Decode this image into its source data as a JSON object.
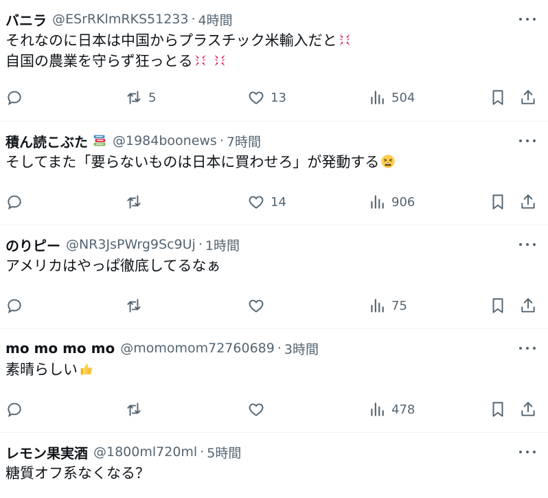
{
  "replies": [
    {
      "display_name": "バニラ",
      "handle": "@ESrRKlmRKS51233",
      "time": "4時間",
      "lines": [
        "それなのに日本は中国からプラスチック米輸入だと",
        "自国の農業を守らず狂っとる"
      ],
      "line_emojis": [
        [
          "anger-emoji"
        ],
        [
          "anger-emoji",
          "anger-emoji"
        ]
      ],
      "reposts": "5",
      "likes": "13",
      "views": "504"
    },
    {
      "display_name": "積ん読こぶた",
      "name_emoji": "books-emoji",
      "handle": "@1984boonews",
      "time": "7時間",
      "lines": [
        "そしてまた「要らないものは日本に買わせろ」が発動する"
      ],
      "line_emojis": [
        [
          "weary-face-emoji"
        ]
      ],
      "reposts": "",
      "likes": "14",
      "views": "906"
    },
    {
      "display_name": "のりピー",
      "handle": "@NR3JsPWrg9Sc9Uj",
      "time": "1時間",
      "lines": [
        "アメリカはやっぱ徹底してるなぁ"
      ],
      "reposts": "",
      "likes": "",
      "views": "75"
    },
    {
      "display_name": "mo mo mo mo",
      "handle": "@momomom72760689",
      "time": "3時間",
      "lines": [
        "素晴らしい"
      ],
      "line_emojis": [
        [
          "thumbs-up-emoji"
        ]
      ],
      "reposts": "",
      "likes": "",
      "views": "478"
    },
    {
      "display_name": "レモン果実酒",
      "handle": "@1800ml720ml",
      "time": "5時間",
      "lines": [
        "糖質オフ系なくなる？"
      ]
    }
  ],
  "separator": "·",
  "icons": {
    "reply": "reply-icon",
    "repost": "repost-icon",
    "like": "heart-icon",
    "views": "views-icon",
    "bookmark": "bookmark-icon",
    "share": "share-icon",
    "more": "more-icon"
  },
  "colors": {
    "text": "#0f1419",
    "secondary": "#536471",
    "divider": "#eff3f4",
    "anger_emoji": "#e0245e",
    "thumbs_up": "#f4b400"
  }
}
